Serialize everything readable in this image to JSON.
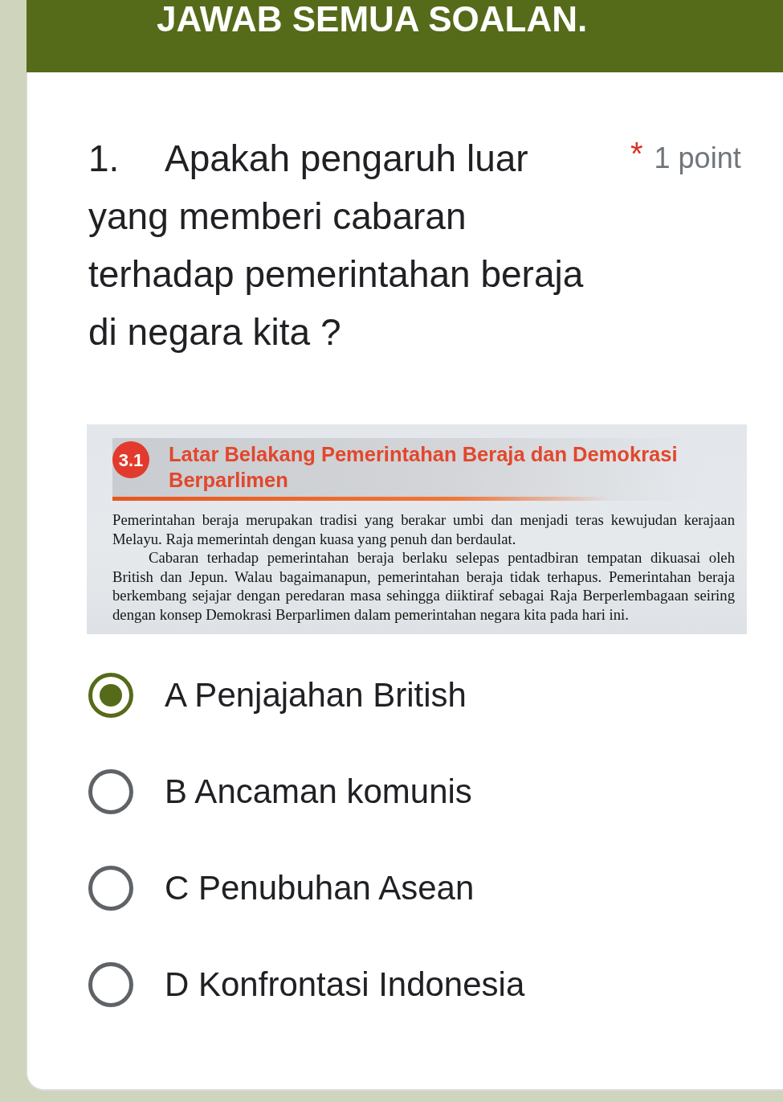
{
  "form": {
    "title": "JAWAB SEMUA SOALAN."
  },
  "question": {
    "number": "1.",
    "text": "Apakah pengaruh luar yang memberi cabaran terhadap pemerintahan beraja di negara kita ?",
    "required_mark": "*",
    "points": "1 point",
    "excerpt": {
      "section_number": "3.1",
      "heading": "Latar Belakang Pemerintahan Beraja dan Demokrasi Berparlimen",
      "paragraphs": [
        "Pemerintahan beraja merupakan tradisi yang berakar umbi dan menjadi teras kewujudan kerajaan Melayu. Raja memerintah dengan kuasa yang penuh dan berdaulat.",
        "Cabaran terhadap pemerintahan beraja berlaku selepas pentadbiran tempatan dikuasai oleh British dan Jepun. Walau bagaimanapun, pemerintahan beraja tidak terhapus. Pemerintahan beraja berkembang sejajar dengan peredaran masa sehingga diiktiraf sebagai Raja Berperlembagaan seiring dengan konsep Demokrasi Berparlimen dalam pemerintahan negara kita pada hari ini."
      ]
    },
    "options": [
      {
        "label": "A Penjajahan British",
        "selected": true
      },
      {
        "label": "B Ancaman komunis",
        "selected": false
      },
      {
        "label": "C Penubuhan Asean",
        "selected": false
      },
      {
        "label": "D Konfrontasi Indonesia",
        "selected": false
      }
    ]
  }
}
